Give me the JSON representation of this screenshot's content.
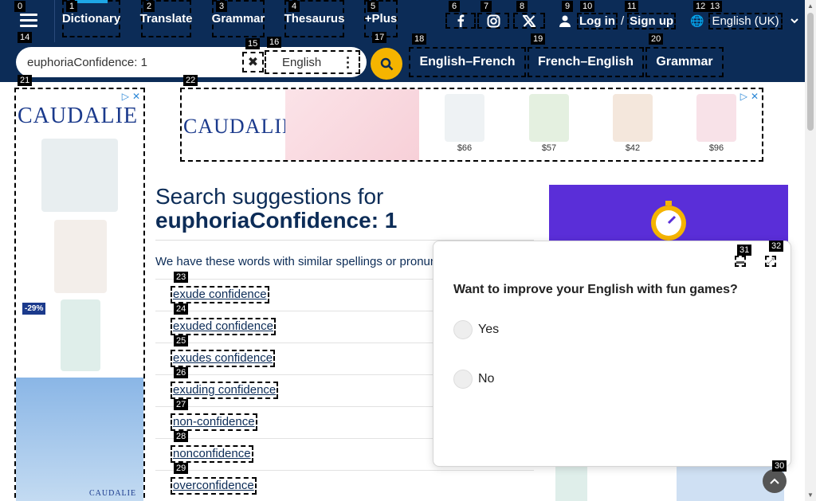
{
  "nav": {
    "menu_icon": "hamburger-icon",
    "links": [
      {
        "label": "Dictionary",
        "active": true
      },
      {
        "label": "Translate"
      },
      {
        "label": "Grammar"
      },
      {
        "label": "Thesaurus"
      },
      {
        "label": "+Plus"
      }
    ],
    "social": [
      "facebook-icon",
      "instagram-icon",
      "x-icon"
    ],
    "login": "Log in",
    "login_sep": "/",
    "signup": "Sign up",
    "language": "English (UK)"
  },
  "search": {
    "value": "euphoriaConfidence: 1",
    "clear_glyph": "✖",
    "language": "English",
    "tabs": [
      "English–French",
      "French–English",
      "Grammar"
    ]
  },
  "ads": {
    "brand": "CAUDALIE",
    "discount": "-29%",
    "prices": [
      "$66",
      "$57",
      "$42",
      "$96"
    ]
  },
  "results": {
    "title_prefix": "Search suggestions for",
    "title_query": "euphoriaConfidence: 1",
    "subtext": "We have these words with similar spellings or pronunciations",
    "suggestions": [
      "exude confidence",
      "exuded confidence",
      "exudes confidence",
      "exuding confidence",
      "non-confidence",
      "nonconfidence",
      "overconfidence"
    ]
  },
  "popup": {
    "question": "Want to improve your English with fun games?",
    "options": [
      "Yes",
      "No"
    ]
  },
  "badges": {
    "b0": "0",
    "b1": "1",
    "b2": "2",
    "b3": "3",
    "b4": "4",
    "b5": "5",
    "b6": "6",
    "b7": "7",
    "b8": "8",
    "b9": "9",
    "b10": "10",
    "b11": "11",
    "b12": "12",
    "b13": "13",
    "b14": "14",
    "b15": "15",
    "b16": "16",
    "b17": "17",
    "b18": "18",
    "b19": "19",
    "b20": "20",
    "b21": "21",
    "b22": "22",
    "b23": "23",
    "b24": "24",
    "b25": "25",
    "b26": "26",
    "b27": "27",
    "b28": "28",
    "b29": "29",
    "b30": "30",
    "b31": "31",
    "b32": "32"
  }
}
